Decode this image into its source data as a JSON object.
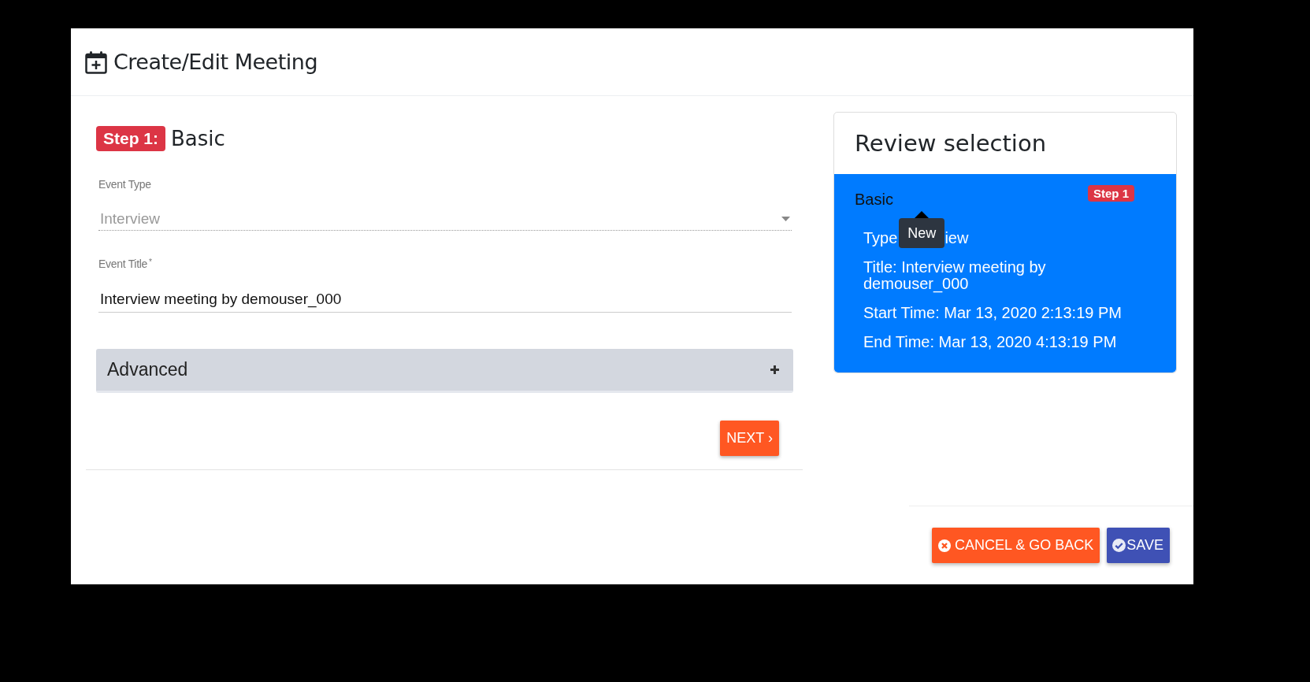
{
  "dialog": {
    "title": "Create/Edit Meeting"
  },
  "step": {
    "badge": "Step 1:",
    "title": "Basic"
  },
  "fields": [
    {
      "kind": "select",
      "label": "Event Type",
      "value": "Interview",
      "disabled": true
    },
    {
      "kind": "text",
      "label": "Event Title",
      "required_mark": "*",
      "value": "Interview meeting by demouser_000",
      "disabled": false
    }
  ],
  "advanced": {
    "label": "Advanced",
    "expanded": false
  },
  "next_button": {
    "label": "NEXT",
    "caret": "›"
  },
  "review": {
    "title": "Review selection",
    "section": "Basic",
    "badge": "Step 1",
    "tooltip": "New",
    "covered_line": [
      "Type",
      "iew"
    ],
    "lines": [
      "Title: Interview meeting by demouser_000",
      "Start Time: Mar 13, 2020 2:13:19 PM",
      "End Time: Mar 13, 2020 4:13:19 PM"
    ]
  },
  "buttons": [
    {
      "kind": "cancel",
      "label": "CANCEL & GO BACK"
    },
    {
      "kind": "save",
      "label": "SAVE"
    }
  ]
}
